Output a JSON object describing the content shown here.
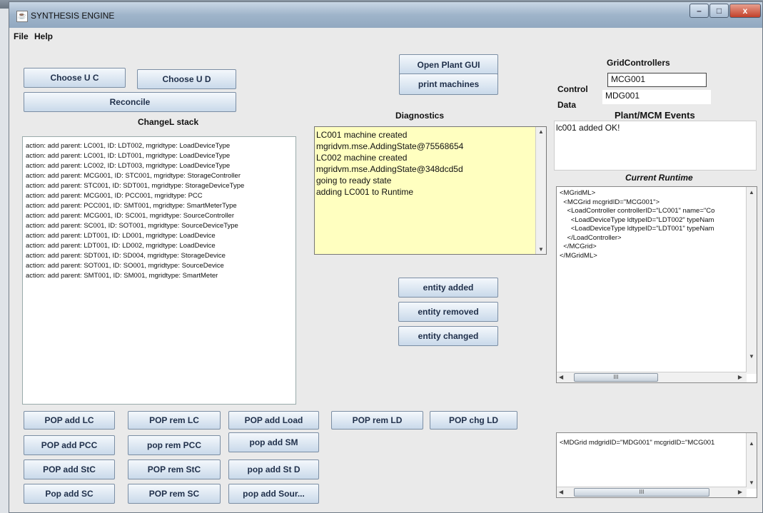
{
  "window": {
    "title": "SYNTHESIS ENGINE",
    "icon": "java-icon"
  },
  "window_controls": {
    "minimize": "–",
    "maximize": "□",
    "close": "x"
  },
  "menu": [
    "File",
    "Help"
  ],
  "top_buttons": {
    "choose_uc": "Choose U C",
    "choose_ud": "Choose U D",
    "reconcile": "Reconcile"
  },
  "changel_stack": {
    "label": "ChangeL stack",
    "items": [
      "action: add  parent: LC001, ID: LDT002, mgridtype: LoadDeviceType",
      "action: add  parent: LC001, ID: LDT001, mgridtype: LoadDeviceType",
      "action: add  parent: LC002, ID: LDT003, mgridtype: LoadDeviceType",
      "action: add  parent: MCG001, ID: STC001, mgridtype: StorageController",
      "action: add  parent: STC001, ID: SDT001, mgridtype: StorageDeviceType",
      "action: add  parent: MCG001, ID: PCC001, mgridtype: PCC",
      "action: add  parent: PCC001, ID: SMT001, mgridtype: SmartMeterType",
      "action: add  parent: MCG001, ID: SC001, mgridtype: SourceController",
      "action: add  parent: SC001, ID: SOT001, mgridtype: SourceDeviceType",
      "action: add  parent: LDT001, ID: LD001, mgridtype: LoadDevice",
      "action: add  parent: LDT001, ID: LD002, mgridtype: LoadDevice",
      "action: add  parent: SDT001, ID: SD004, mgridtype: StorageDevice",
      "action: add  parent: SOT001, ID: SO001, mgridtype: SourceDevice",
      "action: add  parent: SMT001, ID: SM001, mgridtype: SmartMeter"
    ]
  },
  "middle_buttons": {
    "open_plant_gui": "Open Plant GUI",
    "print_machines": "print machines",
    "entity_added": "entity added",
    "entity_removed": "entity removed",
    "entity_changed": "entity changed"
  },
  "diagnostics": {
    "label": "Diagnostics",
    "lines": [
      " LC001 machine created",
      "mgridvm.mse.AddingState@75568654",
      "LC002 machine created",
      "mgridvm.mse.AddingState@348dcd5d",
      " going to ready state",
      "adding LC001 to Runtime"
    ]
  },
  "grid_controllers": {
    "label": "GridControllers",
    "control_label": "Control",
    "control_value": "MCG001",
    "data_label": "Data",
    "data_value": "MDG001"
  },
  "events": {
    "label": "Plant/MCM Events",
    "text": "lc001 added OK!"
  },
  "runtime": {
    "label": "Current Runtime",
    "lines": [
      "<MGridML>",
      "  <MCGrid mcgridID=\"MCG001\">",
      "    <LoadController controllerID=\"LC001\" name=\"Co",
      "      <LoadDeviceType ldtypeID=\"LDT002\" typeNam",
      "      <LoadDeviceType ldtypeID=\"LDT001\" typeNam",
      "    </LoadController>",
      "  </MCGrid>",
      "</MGridML>"
    ],
    "thumb": "III"
  },
  "mdgrid": {
    "text": "<MDGrid mdgridID=\"MDG001\" mcgridID=\"MCG001",
    "thumb": "III"
  },
  "pop_buttons": {
    "pop_add_lc": "POP add LC",
    "pop_rem_lc": "POP rem LC",
    "pop_add_load": "POP add Load",
    "pop_rem_ld": "POP rem LD",
    "pop_chg_ld": "POP chg LD",
    "pop_add_pcc": "POP add PCC",
    "pop_rem_pcc": "pop rem PCC",
    "pop_add_sm": "pop add SM",
    "pop_add_stc": "POP add StC",
    "pop_rem_stc": "POP rem StC",
    "pop_add_std": "pop add St D",
    "pop_add_sc": "Pop add SC",
    "pop_rem_sc": "POP rem SC",
    "pop_add_source": "pop add Sour..."
  }
}
